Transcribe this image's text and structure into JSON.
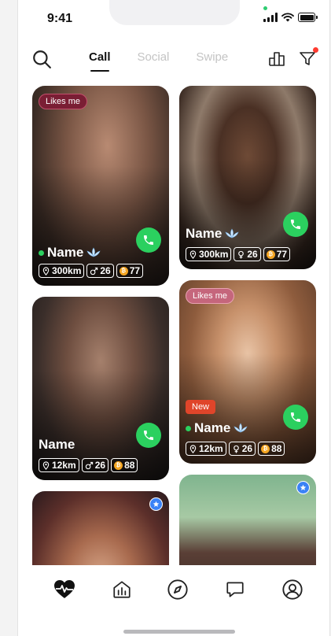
{
  "status_bar": {
    "time": "9:41"
  },
  "header": {
    "tabs": [
      {
        "label": "Call",
        "active": true
      },
      {
        "label": "Social",
        "active": false
      },
      {
        "label": "Swipe",
        "active": false
      }
    ],
    "icons": [
      "search-icon",
      "leaderboard-icon",
      "filter-icon"
    ]
  },
  "cards": [
    {
      "tag": "Likes me",
      "name": "Name",
      "online": true,
      "verified": true,
      "distance": "300km",
      "gender": "male",
      "age": "26",
      "coins": "77"
    },
    {
      "name": "Name",
      "online": false,
      "verified": true,
      "distance": "300km",
      "gender": "female",
      "age": "26",
      "coins": "77"
    },
    {
      "name": "Name",
      "online": false,
      "verified": false,
      "distance": "12km",
      "gender": "male",
      "age": "26",
      "coins": "88"
    },
    {
      "tag": "Likes me",
      "new_label": "New",
      "name": "Name",
      "online": true,
      "verified": true,
      "distance": "12km",
      "gender": "female",
      "age": "26",
      "coins": "88"
    },
    {
      "badge": "star-icon"
    },
    {
      "badge": "star-icon"
    }
  ],
  "coin_symbol": "₿",
  "bottom_nav": [
    "heartbeat-icon",
    "feed-icon",
    "explore-icon",
    "chat-icon",
    "profile-icon"
  ],
  "colors": {
    "call_green": "#2bd05f",
    "new_red": "#e0452a",
    "likes_me_dark": "#7a1e34",
    "likes_me_pink": "#c5667c",
    "verified_blue": "#3b82f6"
  }
}
